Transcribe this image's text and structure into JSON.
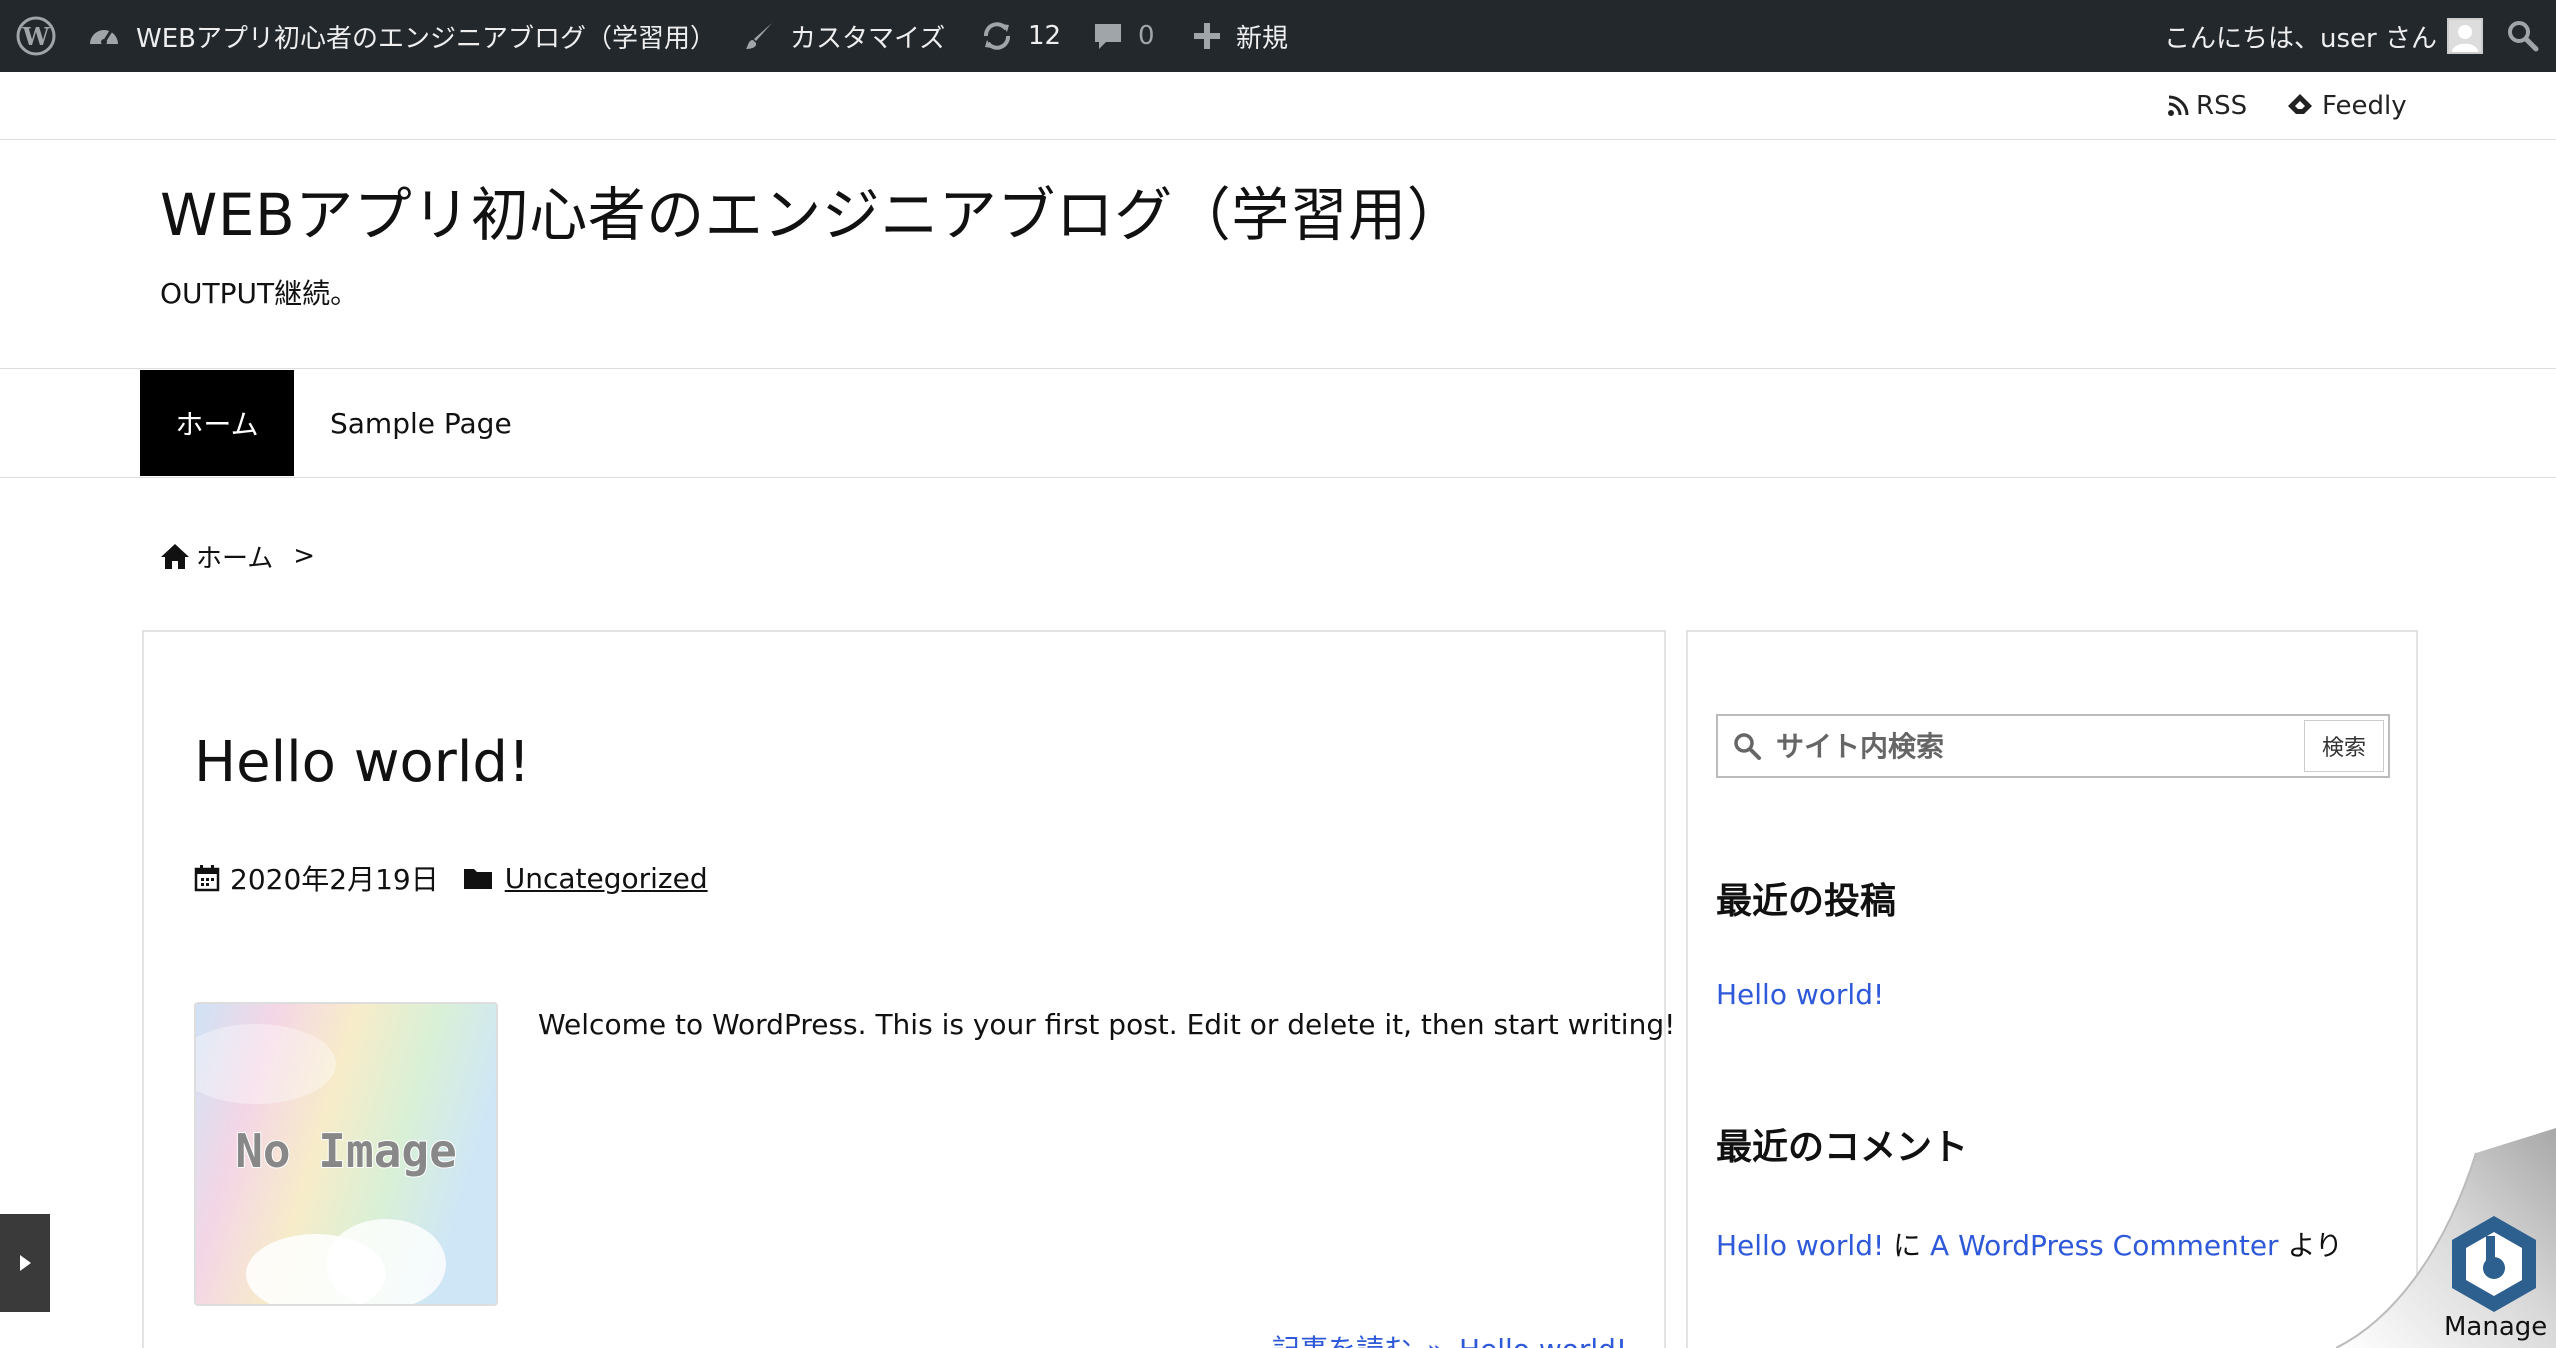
{
  "admin_bar": {
    "site_name": "WEBアプリ初心者のエンジニアブログ（学習用）",
    "customize": "カスタマイズ",
    "updates_count": "12",
    "comments_count": "0",
    "new": "新規",
    "greeting": "こんにちは、user さん"
  },
  "top_links": {
    "rss": "RSS",
    "feedly": "Feedly"
  },
  "header": {
    "title": "WEBアプリ初心者のエンジニアブログ（学習用）",
    "description": "OUTPUT継続。"
  },
  "nav": {
    "items": [
      {
        "label": "ホーム",
        "active": true
      },
      {
        "label": "Sample Page",
        "active": false
      }
    ]
  },
  "breadcrumb": {
    "home": "ホーム",
    "separator": ">"
  },
  "post": {
    "title": "Hello world!",
    "date": "2020年2月19日",
    "category": "Uncategorized",
    "thumbnail_text": "No Image",
    "excerpt": "Welcome to WordPress. This is your first post. Edit or delete it, then start writing!",
    "read_more": "記事を読む",
    "read_more_title": "Hello world!"
  },
  "sidebar": {
    "search_placeholder": "サイト内検索",
    "search_button": "検索",
    "recent_posts_title": "最近の投稿",
    "recent_posts": [
      "Hello world!"
    ],
    "recent_comments_title": "最近のコメント",
    "recent_comment": {
      "post": "Hello world!",
      "particle": "に",
      "author": "A WordPress Commenter",
      "suffix": "より"
    }
  },
  "manage_label": "Manage",
  "colors": {
    "admin_bar_bg": "#23282d",
    "link_blue": "#2e59d9",
    "nav_active_bg": "#000000"
  }
}
